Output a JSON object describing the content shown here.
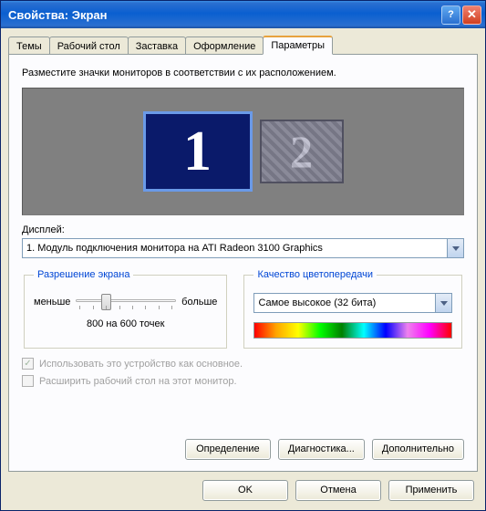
{
  "title": "Свойства: Экран",
  "tabs": {
    "t0": "Темы",
    "t1": "Рабочий стол",
    "t2": "Заставка",
    "t3": "Оформление",
    "t4": "Параметры"
  },
  "instruction": "Разместите значки мониторов в соответствии с их расположением.",
  "monitors": {
    "m1": "1",
    "m2": "2"
  },
  "display": {
    "label": "Дисплей:",
    "value": "1. Модуль подключения монитора на ATI Radeon 3100 Graphics"
  },
  "resolution": {
    "legend": "Разрешение экрана",
    "less": "меньше",
    "more": "больше",
    "value": "800 на 600 точек"
  },
  "quality": {
    "legend": "Качество цветопередачи",
    "value": "Самое высокое (32 бита)"
  },
  "checks": {
    "primary": "Использовать это устройство как основное.",
    "extend": "Расширить рабочий стол на этот монитор."
  },
  "buttons": {
    "identify": "Определение",
    "troubleshoot": "Диагностика...",
    "advanced": "Дополнительно",
    "ok": "OK",
    "cancel": "Отмена",
    "apply": "Применить"
  }
}
